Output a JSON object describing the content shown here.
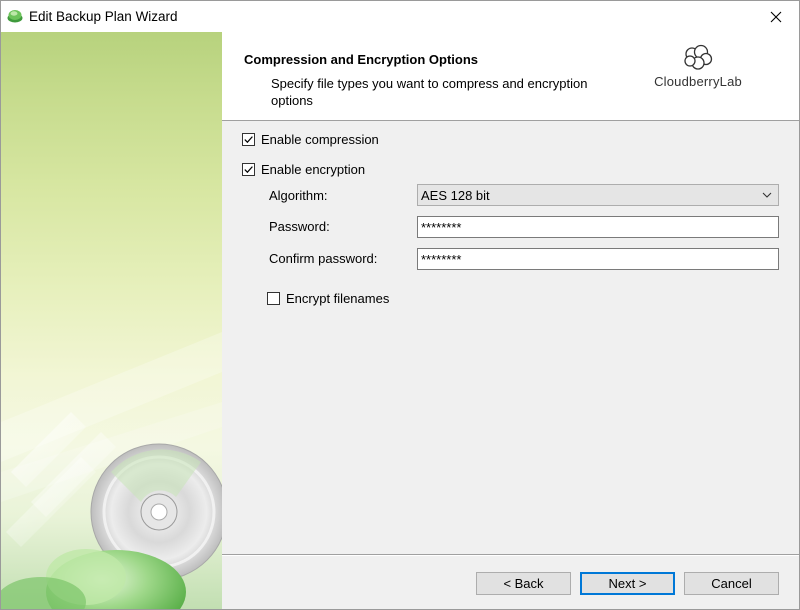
{
  "window": {
    "title": "Edit Backup Plan Wizard"
  },
  "header": {
    "title": "Compression and Encryption Options",
    "subtitle": "Specify file types you want to compress and encryption options",
    "brand": "CloudberryLab"
  },
  "options": {
    "enable_compression": {
      "label": "Enable compression",
      "checked": true
    },
    "enable_encryption": {
      "label": "Enable encryption",
      "checked": true
    },
    "algorithm": {
      "label": "Algorithm:",
      "value": "AES 128 bit"
    },
    "password": {
      "label": "Password:",
      "value": "********"
    },
    "confirm_password": {
      "label": "Confirm password:",
      "value": "********"
    },
    "encrypt_filenames": {
      "label": "Encrypt filenames",
      "checked": false
    }
  },
  "footer": {
    "back_label": "< Back",
    "next_label": "Next >",
    "cancel_label": "Cancel"
  },
  "colors": {
    "focus_border": "#0078d7",
    "side_panel_green": "#b7d27d"
  }
}
